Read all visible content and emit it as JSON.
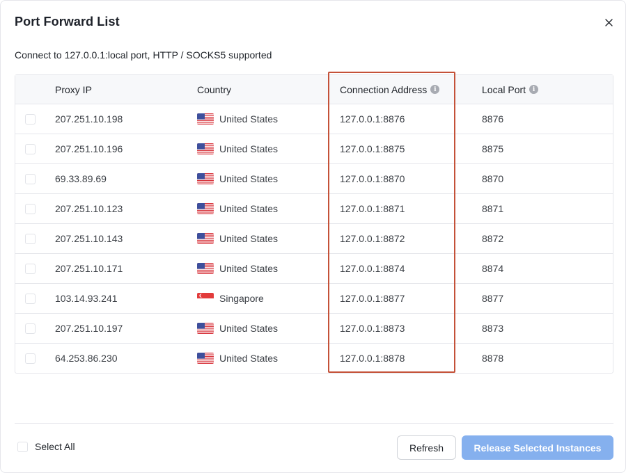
{
  "dialog": {
    "title": "Port Forward List",
    "subtitle": "Connect to 127.0.0.1:local port, HTTP / SOCKS5 supported"
  },
  "table": {
    "columns": {
      "proxy_ip": "Proxy IP",
      "country": "Country",
      "connection_address": "Connection Address",
      "local_port": "Local Port"
    },
    "rows": [
      {
        "proxy_ip": "207.251.10.198",
        "country": "United States",
        "flag": "us-flag-icon",
        "connection_address": "127.0.0.1:8876",
        "local_port": "8876"
      },
      {
        "proxy_ip": "207.251.10.196",
        "country": "United States",
        "flag": "us-flag-icon",
        "connection_address": "127.0.0.1:8875",
        "local_port": "8875"
      },
      {
        "proxy_ip": "69.33.89.69",
        "country": "United States",
        "flag": "us-flag-icon",
        "connection_address": "127.0.0.1:8870",
        "local_port": "8870"
      },
      {
        "proxy_ip": "207.251.10.123",
        "country": "United States",
        "flag": "us-flag-icon",
        "connection_address": "127.0.0.1:8871",
        "local_port": "8871"
      },
      {
        "proxy_ip": "207.251.10.143",
        "country": "United States",
        "flag": "us-flag-icon",
        "connection_address": "127.0.0.1:8872",
        "local_port": "8872"
      },
      {
        "proxy_ip": "207.251.10.171",
        "country": "United States",
        "flag": "us-flag-icon",
        "connection_address": "127.0.0.1:8874",
        "local_port": "8874"
      },
      {
        "proxy_ip": "103.14.93.241",
        "country": "Singapore",
        "flag": "sg-flag-icon",
        "connection_address": "127.0.0.1:8877",
        "local_port": "8877"
      },
      {
        "proxy_ip": "207.251.10.197",
        "country": "United States",
        "flag": "us-flag-icon",
        "connection_address": "127.0.0.1:8873",
        "local_port": "8873"
      },
      {
        "proxy_ip": "64.253.86.230",
        "country": "United States",
        "flag": "us-flag-icon",
        "connection_address": "127.0.0.1:8878",
        "local_port": "8878"
      }
    ]
  },
  "footer": {
    "select_all_label": "Select All",
    "refresh_label": "Refresh",
    "release_label": "Release Selected Instances"
  },
  "icons": {
    "close": "close-icon",
    "info": "info-icon"
  },
  "colors": {
    "primary_button": "#85b0ee",
    "highlight_box": "#c45138",
    "header_bg": "#f7f8fa",
    "border": "#e5e6eb"
  }
}
